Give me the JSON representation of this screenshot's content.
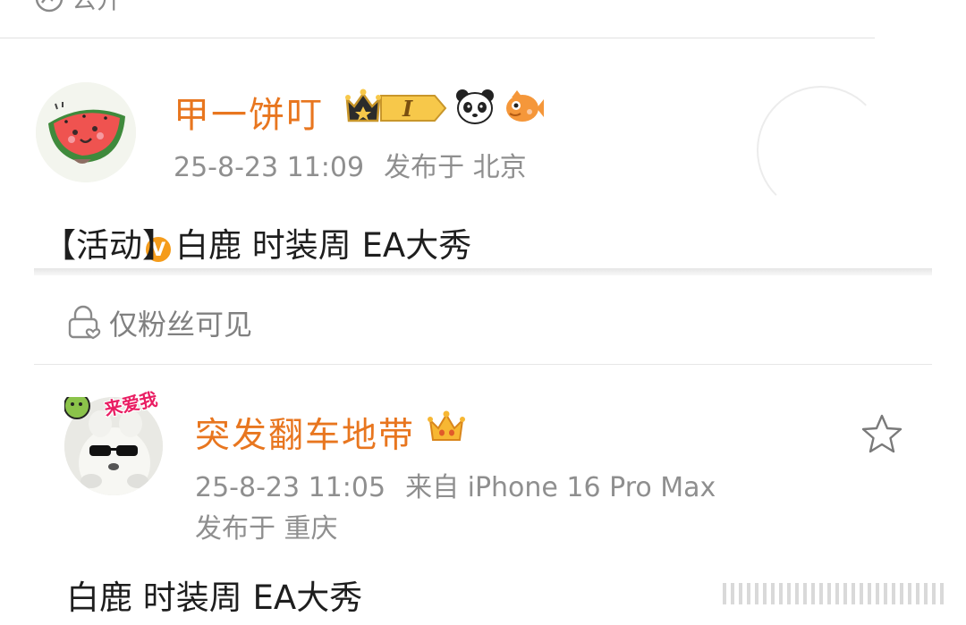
{
  "top": {
    "visibility_label": "公开",
    "icon": "globe-icon"
  },
  "post1": {
    "username": "甲一饼叮",
    "vip_level": "I",
    "badges": [
      "crown-badge-icon",
      "panda-icon",
      "fish-icon"
    ],
    "verified_label": "V",
    "time": "25-8-23 11:09",
    "location": "发布于 北京",
    "content": "【活动】白鹿 时装周 EA大秀",
    "visibility": "仅粉丝可见",
    "colors": {
      "name": "#e8761f",
      "meta": "#8f8f8f",
      "verified": "#f59c1b"
    }
  },
  "post2": {
    "username": "突发翻车地带",
    "avatar_sticker_text": "来爱我",
    "time": "25-8-23 11:05",
    "source": "来自 iPhone 16 Pro Max",
    "location": "发布于 重庆",
    "content": "白鹿 时装周 EA大秀"
  }
}
